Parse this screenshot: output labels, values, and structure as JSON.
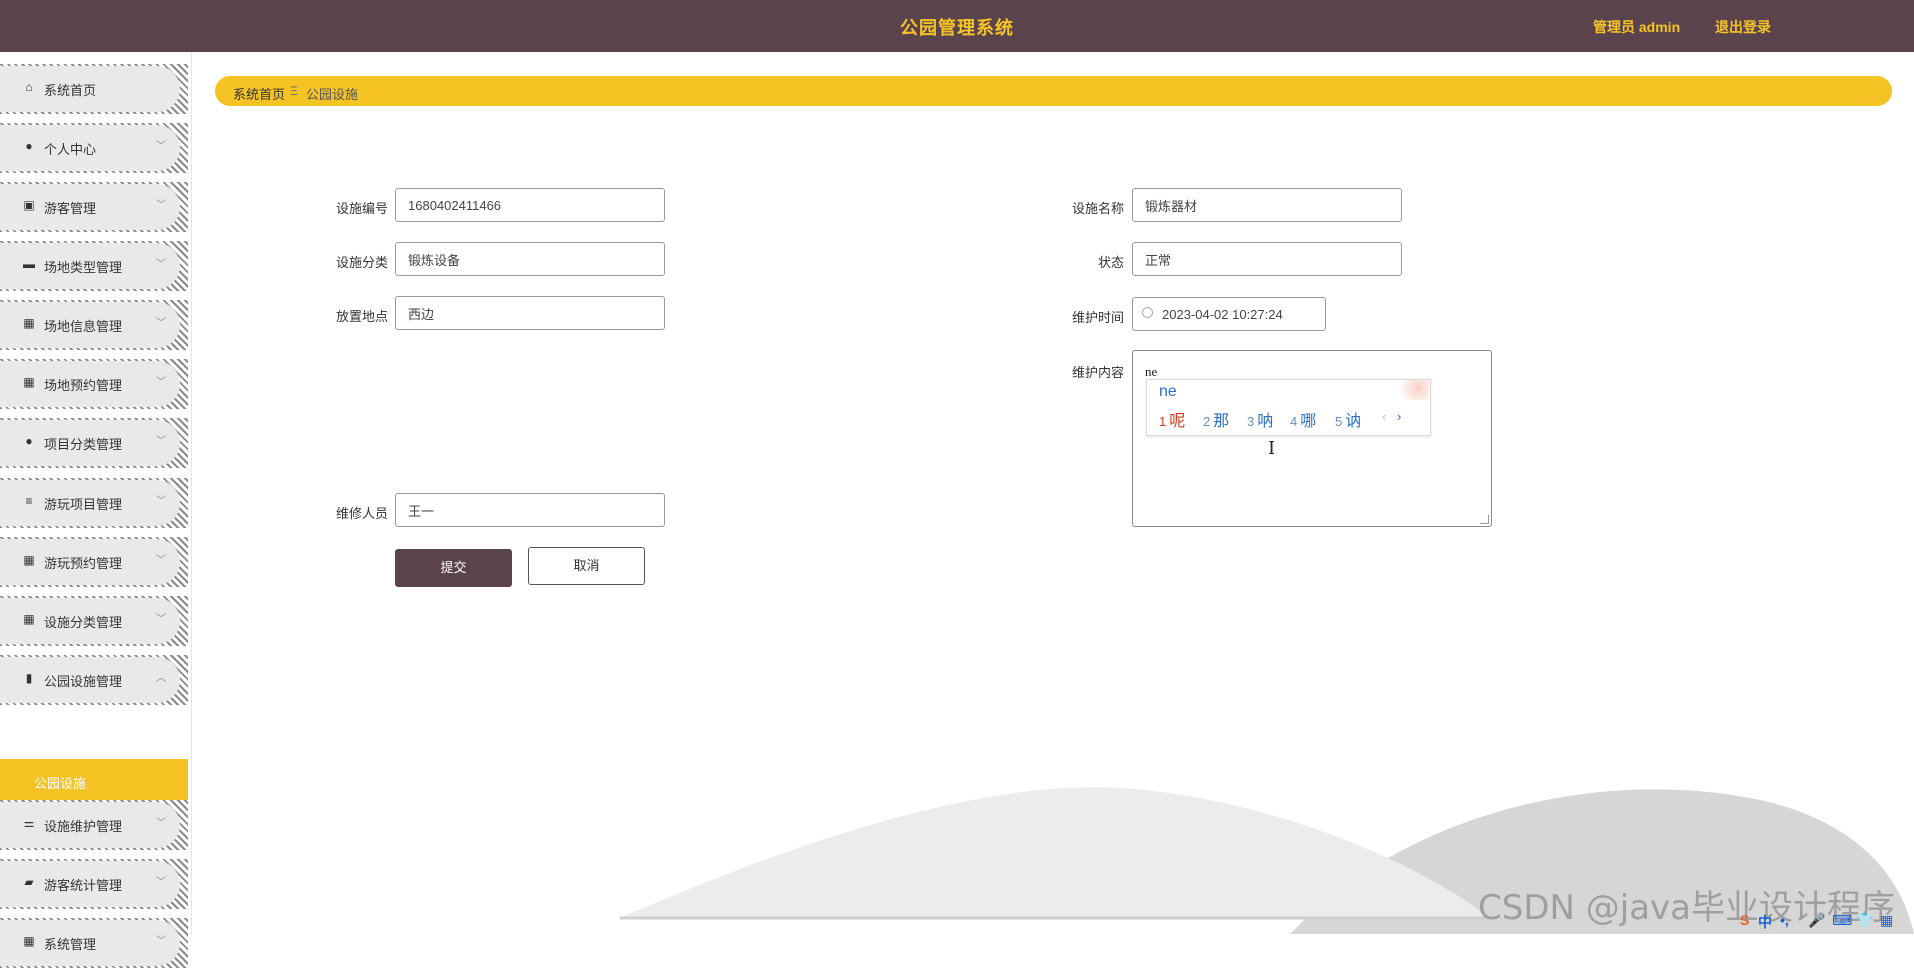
{
  "header": {
    "title": "公园管理系统",
    "admin_label": "管理员 admin",
    "logout_label": "退出登录"
  },
  "sidebar": {
    "items": [
      {
        "label": "系统首页",
        "icon": "home-icon",
        "arrow": ""
      },
      {
        "label": "个人中心",
        "icon": "user-icon",
        "arrow": "﹀"
      },
      {
        "label": "游客管理",
        "icon": "clipboard-icon",
        "arrow": "﹀"
      },
      {
        "label": "场地类型管理",
        "icon": "monitor-icon",
        "arrow": "﹀"
      },
      {
        "label": "场地信息管理",
        "icon": "grid-icon",
        "arrow": "﹀"
      },
      {
        "label": "场地预约管理",
        "icon": "grid-icon",
        "arrow": "﹀"
      },
      {
        "label": "项目分类管理",
        "icon": "user-icon",
        "arrow": "﹀"
      },
      {
        "label": "游玩项目管理",
        "icon": "list-icon",
        "arrow": "﹀"
      },
      {
        "label": "游玩预约管理",
        "icon": "grid-icon",
        "arrow": "﹀"
      },
      {
        "label": "设施分类管理",
        "icon": "grid-icon",
        "arrow": "﹀"
      },
      {
        "label": "公园设施管理",
        "icon": "bar-chart-icon",
        "arrow": "︿"
      },
      {
        "label": "设施维护管理",
        "icon": "sliders-icon",
        "arrow": "﹀"
      },
      {
        "label": "游客统计管理",
        "icon": "briefcase-icon",
        "arrow": "﹀"
      },
      {
        "label": "系统管理",
        "icon": "grid-icon",
        "arrow": "﹀"
      }
    ],
    "active_submenu": "公园设施"
  },
  "breadcrumb": {
    "home": "系统首页",
    "separator": "Ξ",
    "current": "公园设施"
  },
  "form": {
    "facility_no_label": "设施编号",
    "facility_no_value": "1680402411466",
    "facility_name_label": "设施名称",
    "facility_name_value": "锻炼器材",
    "category_label": "设施分类",
    "category_value": "锻炼设备",
    "status_label": "状态",
    "status_value": "正常",
    "location_label": "放置地点",
    "location_value": "西边",
    "maint_time_label": "维护时间",
    "maint_time_value": "2023-04-02 10:27:24",
    "maint_content_label": "维护内容",
    "maint_content_value": "ne",
    "maintainer_label": "维修人员",
    "maintainer_value": "王一",
    "submit_label": "提交",
    "cancel_label": "取消"
  },
  "ime": {
    "typed": "ne",
    "candidates": [
      {
        "num": "1",
        "text": "呢"
      },
      {
        "num": "2",
        "text": "那"
      },
      {
        "num": "3",
        "text": "呐"
      },
      {
        "num": "4",
        "text": "哪"
      },
      {
        "num": "5",
        "text": "讷"
      }
    ],
    "prev": "‹",
    "next": "›"
  },
  "watermark": "CSDN @java毕业设计程序",
  "tray": {
    "ime_mode": "中",
    "items": [
      "•,",
      "🎤",
      "⌨",
      "👕",
      "▦"
    ]
  },
  "colors": {
    "header_bg": "#5b434d",
    "accent_yellow": "#f6c325",
    "button_dark": "#5b434d"
  }
}
